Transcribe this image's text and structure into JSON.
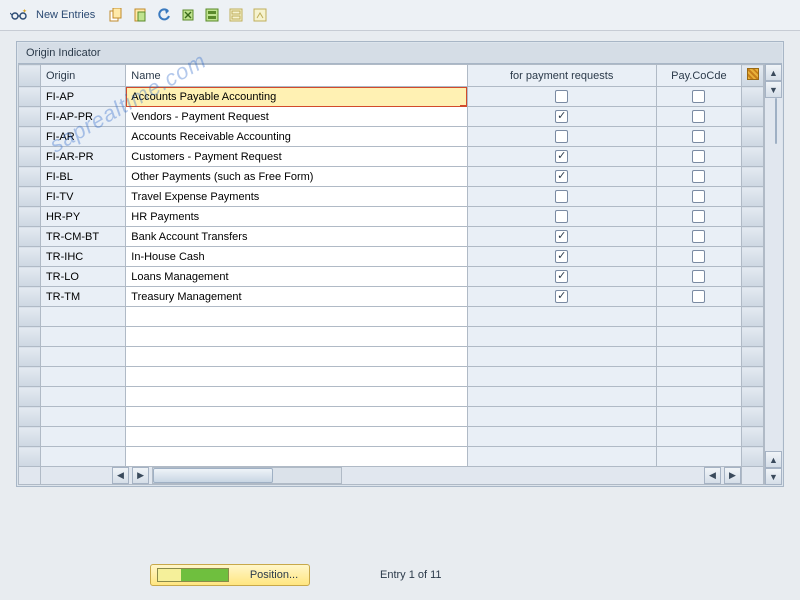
{
  "toolbar": {
    "new_entries_label": "New Entries",
    "icons": [
      "glasses-icon",
      "copy-icon",
      "paste-icon",
      "undo-icon",
      "delete-icon",
      "select-all-icon",
      "deselect-icon",
      "export-icon"
    ]
  },
  "panel": {
    "title": "Origin Indicator"
  },
  "columns": {
    "origin": "Origin",
    "name": "Name",
    "for_payment": "for payment requests",
    "pay_cocde": "Pay.CoCde"
  },
  "rows": [
    {
      "origin": "FI-AP",
      "name": "Accounts Payable Accounting",
      "for_payment": false,
      "pay_cocde": false,
      "selected": true
    },
    {
      "origin": "FI-AP-PR",
      "name": "Vendors - Payment Request",
      "for_payment": true,
      "pay_cocde": false
    },
    {
      "origin": "FI-AR",
      "name": "Accounts Receivable Accounting",
      "for_payment": false,
      "pay_cocde": false
    },
    {
      "origin": "FI-AR-PR",
      "name": "Customers - Payment Request",
      "for_payment": true,
      "pay_cocde": false
    },
    {
      "origin": "FI-BL",
      "name": "Other Payments (such as Free Form)",
      "for_payment": true,
      "pay_cocde": false
    },
    {
      "origin": "FI-TV",
      "name": "Travel Expense Payments",
      "for_payment": false,
      "pay_cocde": false
    },
    {
      "origin": "HR-PY",
      "name": "HR Payments",
      "for_payment": false,
      "pay_cocde": false
    },
    {
      "origin": "TR-CM-BT",
      "name": "Bank Account Transfers",
      "for_payment": true,
      "pay_cocde": false
    },
    {
      "origin": "TR-IHC",
      "name": "In-House Cash",
      "for_payment": true,
      "pay_cocde": false
    },
    {
      "origin": "TR-LO",
      "name": "Loans Management",
      "for_payment": true,
      "pay_cocde": false
    },
    {
      "origin": "TR-TM",
      "name": "Treasury Management",
      "for_payment": true,
      "pay_cocde": false
    }
  ],
  "empty_rows": 8,
  "footer": {
    "position_label": "Position...",
    "entry_text": "Entry 1 of 11"
  },
  "watermark": "saprealtime.com"
}
